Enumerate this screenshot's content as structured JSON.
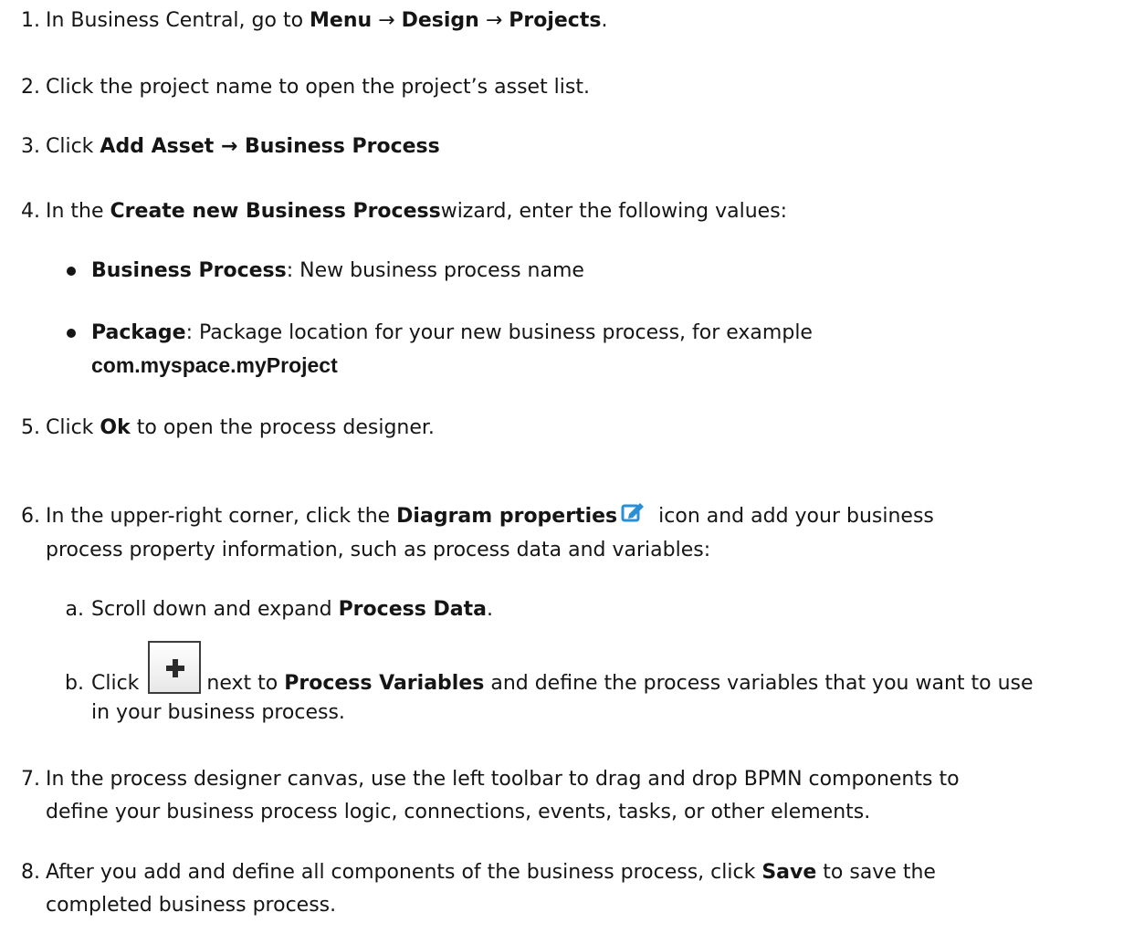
{
  "steps": [
    {
      "num": "1.",
      "pre": "In Business Central, go to ",
      "b1": "Menu",
      "a1": " → ",
      "b2": "Design",
      "a2": " → ",
      "b3": "Projects",
      "post": "."
    },
    {
      "num": "2.",
      "text": "Click the project name to open the project’s asset list."
    },
    {
      "num": "3.",
      "pre": "Click ",
      "b1": "Add Asset → Business Process"
    },
    {
      "num": "4.",
      "pre": "In the ",
      "b1": "Create new Business Process",
      "post": "wizard, enter the following values:"
    },
    {
      "bullets": [
        {
          "term": "Business Process",
          "text": ": New business process name"
        },
        {
          "term": "Package",
          "text": ": Package location for your new business process, for example",
          "code": "com.myspace.myProject"
        }
      ]
    },
    {
      "num": "5.",
      "pre": "Click ",
      "b1": "Ok",
      "post": " to open the process designer."
    },
    {
      "num": "6.",
      "pre": "In the upper-right corner, click the ",
      "b1": "Diagram properties",
      "post": " icon and add your business",
      "line2": "process property information, such as process data and variables:",
      "icon": "edit-icon"
    },
    {
      "num": "a.",
      "pre": "Scroll down and expand ",
      "b1": "Process Data",
      "post": "."
    },
    {
      "num": "b.",
      "pre": "Click ",
      "icon": "plus-button",
      "mid": " next to ",
      "b1": "Process Variables",
      "post": " and define the process variables that you want to use",
      "line2": "in your business process."
    },
    {
      "num": "7.",
      "text": "In the process designer canvas, use the left toolbar to drag and drop BPMN components to",
      "line2": "define your business process logic, connections, events, tasks, or other elements."
    },
    {
      "num": "8.",
      "pre": "After you add and define all components of the business process, click ",
      "b1": "Save",
      "post": " to save the",
      "line2": "completed business process."
    }
  ]
}
